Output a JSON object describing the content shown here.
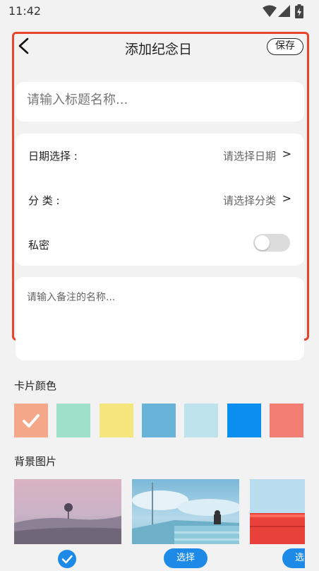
{
  "status": {
    "time": "11:42"
  },
  "header": {
    "title": "添加纪念日",
    "save_label": "保存"
  },
  "form": {
    "title_placeholder": "请输入标题名称...",
    "date_label": "日期选择 :",
    "date_value": "请选择日期",
    "category_label": "分 类 :",
    "category_value": "请选择分类",
    "chevron": ">",
    "private_label": "私密",
    "private_on": false,
    "note_placeholder": "请输入备注的名称..."
  },
  "card_color": {
    "title": "卡片颜色",
    "colors": [
      "#f5a889",
      "#9fe0cb",
      "#f4e67c",
      "#6ab3d8",
      "#bfe3ec",
      "#0a8ef0",
      "#f27d73"
    ],
    "selected_index": 0
  },
  "background": {
    "title": "背景图片",
    "select_label": "选择",
    "selected_index": 0
  },
  "icons": {
    "back": "back-arrow-icon",
    "check": "check-icon",
    "wifi": "wifi-icon",
    "signal": "signal-icon",
    "battery": "battery-icon"
  }
}
